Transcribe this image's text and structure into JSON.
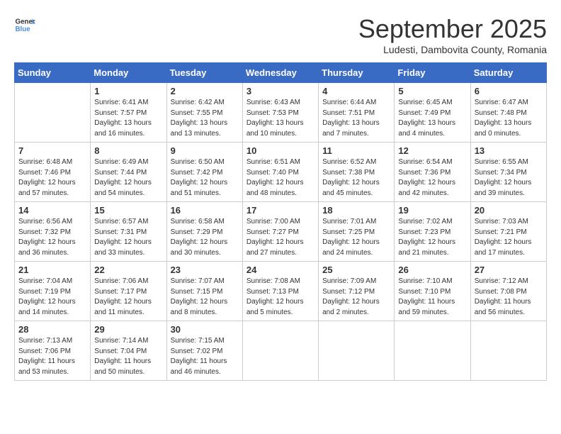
{
  "logo": {
    "general": "General",
    "blue": "Blue"
  },
  "title": "September 2025",
  "location": "Ludesti, Dambovita County, Romania",
  "days_of_week": [
    "Sunday",
    "Monday",
    "Tuesday",
    "Wednesday",
    "Thursday",
    "Friday",
    "Saturday"
  ],
  "weeks": [
    [
      {
        "day": "",
        "info": ""
      },
      {
        "day": "1",
        "info": "Sunrise: 6:41 AM\nSunset: 7:57 PM\nDaylight: 13 hours\nand 16 minutes."
      },
      {
        "day": "2",
        "info": "Sunrise: 6:42 AM\nSunset: 7:55 PM\nDaylight: 13 hours\nand 13 minutes."
      },
      {
        "day": "3",
        "info": "Sunrise: 6:43 AM\nSunset: 7:53 PM\nDaylight: 13 hours\nand 10 minutes."
      },
      {
        "day": "4",
        "info": "Sunrise: 6:44 AM\nSunset: 7:51 PM\nDaylight: 13 hours\nand 7 minutes."
      },
      {
        "day": "5",
        "info": "Sunrise: 6:45 AM\nSunset: 7:49 PM\nDaylight: 13 hours\nand 4 minutes."
      },
      {
        "day": "6",
        "info": "Sunrise: 6:47 AM\nSunset: 7:48 PM\nDaylight: 13 hours\nand 0 minutes."
      }
    ],
    [
      {
        "day": "7",
        "info": "Sunrise: 6:48 AM\nSunset: 7:46 PM\nDaylight: 12 hours\nand 57 minutes."
      },
      {
        "day": "8",
        "info": "Sunrise: 6:49 AM\nSunset: 7:44 PM\nDaylight: 12 hours\nand 54 minutes."
      },
      {
        "day": "9",
        "info": "Sunrise: 6:50 AM\nSunset: 7:42 PM\nDaylight: 12 hours\nand 51 minutes."
      },
      {
        "day": "10",
        "info": "Sunrise: 6:51 AM\nSunset: 7:40 PM\nDaylight: 12 hours\nand 48 minutes."
      },
      {
        "day": "11",
        "info": "Sunrise: 6:52 AM\nSunset: 7:38 PM\nDaylight: 12 hours\nand 45 minutes."
      },
      {
        "day": "12",
        "info": "Sunrise: 6:54 AM\nSunset: 7:36 PM\nDaylight: 12 hours\nand 42 minutes."
      },
      {
        "day": "13",
        "info": "Sunrise: 6:55 AM\nSunset: 7:34 PM\nDaylight: 12 hours\nand 39 minutes."
      }
    ],
    [
      {
        "day": "14",
        "info": "Sunrise: 6:56 AM\nSunset: 7:32 PM\nDaylight: 12 hours\nand 36 minutes."
      },
      {
        "day": "15",
        "info": "Sunrise: 6:57 AM\nSunset: 7:31 PM\nDaylight: 12 hours\nand 33 minutes."
      },
      {
        "day": "16",
        "info": "Sunrise: 6:58 AM\nSunset: 7:29 PM\nDaylight: 12 hours\nand 30 minutes."
      },
      {
        "day": "17",
        "info": "Sunrise: 7:00 AM\nSunset: 7:27 PM\nDaylight: 12 hours\nand 27 minutes."
      },
      {
        "day": "18",
        "info": "Sunrise: 7:01 AM\nSunset: 7:25 PM\nDaylight: 12 hours\nand 24 minutes."
      },
      {
        "day": "19",
        "info": "Sunrise: 7:02 AM\nSunset: 7:23 PM\nDaylight: 12 hours\nand 21 minutes."
      },
      {
        "day": "20",
        "info": "Sunrise: 7:03 AM\nSunset: 7:21 PM\nDaylight: 12 hours\nand 17 minutes."
      }
    ],
    [
      {
        "day": "21",
        "info": "Sunrise: 7:04 AM\nSunset: 7:19 PM\nDaylight: 12 hours\nand 14 minutes."
      },
      {
        "day": "22",
        "info": "Sunrise: 7:06 AM\nSunset: 7:17 PM\nDaylight: 12 hours\nand 11 minutes."
      },
      {
        "day": "23",
        "info": "Sunrise: 7:07 AM\nSunset: 7:15 PM\nDaylight: 12 hours\nand 8 minutes."
      },
      {
        "day": "24",
        "info": "Sunrise: 7:08 AM\nSunset: 7:13 PM\nDaylight: 12 hours\nand 5 minutes."
      },
      {
        "day": "25",
        "info": "Sunrise: 7:09 AM\nSunset: 7:12 PM\nDaylight: 12 hours\nand 2 minutes."
      },
      {
        "day": "26",
        "info": "Sunrise: 7:10 AM\nSunset: 7:10 PM\nDaylight: 11 hours\nand 59 minutes."
      },
      {
        "day": "27",
        "info": "Sunrise: 7:12 AM\nSunset: 7:08 PM\nDaylight: 11 hours\nand 56 minutes."
      }
    ],
    [
      {
        "day": "28",
        "info": "Sunrise: 7:13 AM\nSunset: 7:06 PM\nDaylight: 11 hours\nand 53 minutes."
      },
      {
        "day": "29",
        "info": "Sunrise: 7:14 AM\nSunset: 7:04 PM\nDaylight: 11 hours\nand 50 minutes."
      },
      {
        "day": "30",
        "info": "Sunrise: 7:15 AM\nSunset: 7:02 PM\nDaylight: 11 hours\nand 46 minutes."
      },
      {
        "day": "",
        "info": ""
      },
      {
        "day": "",
        "info": ""
      },
      {
        "day": "",
        "info": ""
      },
      {
        "day": "",
        "info": ""
      }
    ]
  ]
}
